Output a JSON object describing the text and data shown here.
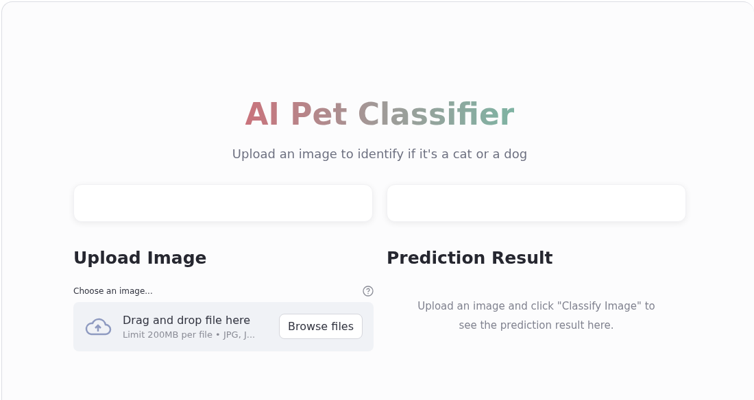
{
  "header": {
    "title": "AI Pet Classifier",
    "subtitle": "Upload an image to identify if it's a cat or a dog"
  },
  "cards": [
    {
      "kind": "empty"
    },
    {
      "kind": "empty"
    }
  ],
  "upload": {
    "heading": "Upload Image",
    "label": "Choose an image...",
    "dropzone": {
      "title": "Drag and drop file here",
      "hint": "Limit 200MB per file • JPG, J...",
      "button": "Browse files"
    }
  },
  "result": {
    "heading": "Prediction Result",
    "message": "Upload an image and click \"Classify Image\" to see the prediction result here."
  }
}
